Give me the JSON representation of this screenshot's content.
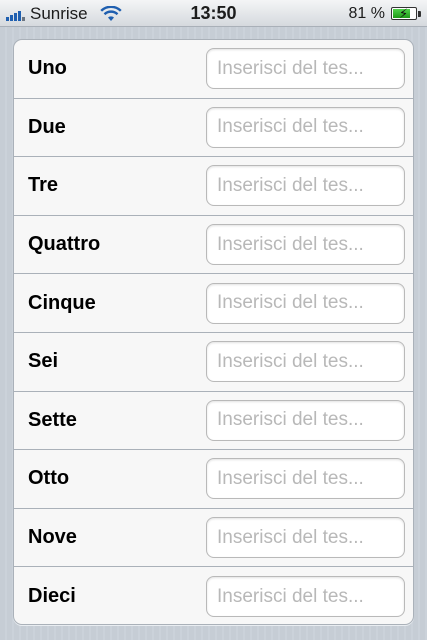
{
  "status_bar": {
    "carrier": "Sunrise",
    "time": "13:50",
    "battery_percent_label": "81 %",
    "battery_level": 0.81,
    "icons": [
      "signal-icon",
      "wifi-icon",
      "battery-charging-icon"
    ]
  },
  "form": {
    "rows": [
      {
        "label": "Uno",
        "placeholder": "Inserisci del tes...",
        "value": ""
      },
      {
        "label": "Due",
        "placeholder": "Inserisci del tes...",
        "value": ""
      },
      {
        "label": "Tre",
        "placeholder": "Inserisci del tes...",
        "value": ""
      },
      {
        "label": "Quattro",
        "placeholder": "Inserisci del tes...",
        "value": ""
      },
      {
        "label": "Cinque",
        "placeholder": "Inserisci del tes...",
        "value": ""
      },
      {
        "label": "Sei",
        "placeholder": "Inserisci del tes...",
        "value": ""
      },
      {
        "label": "Sette",
        "placeholder": "Inserisci del tes...",
        "value": ""
      },
      {
        "label": "Otto",
        "placeholder": "Inserisci del tes...",
        "value": ""
      },
      {
        "label": "Nove",
        "placeholder": "Inserisci del tes...",
        "value": ""
      },
      {
        "label": "Dieci",
        "placeholder": "Inserisci del tes...",
        "value": ""
      }
    ]
  }
}
